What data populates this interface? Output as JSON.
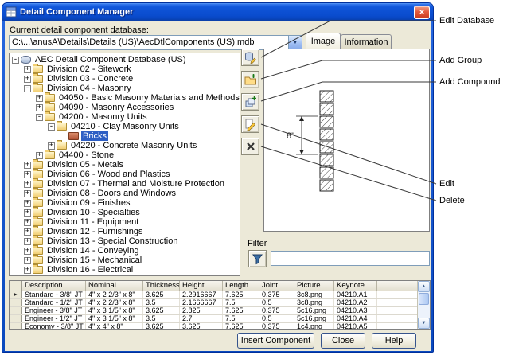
{
  "window": {
    "title": "Detail Component Manager",
    "close_glyph": "×"
  },
  "icons": {
    "scroll_up": "▲",
    "scroll_down": "▼",
    "row_pointer": "►",
    "combo_arrow": "▼"
  },
  "database": {
    "label": "Current detail component database:",
    "value": "C:\\...\\anusA\\Details\\Details (US)\\AecDtlComponents (US).mdb"
  },
  "tabs": [
    {
      "label": "Image"
    },
    {
      "label": "Information"
    }
  ],
  "tree": {
    "items": [
      {
        "level": 0,
        "exp": "-",
        "icon": "db",
        "label": "AEC Detail Component Database (US)"
      },
      {
        "level": 1,
        "exp": "+",
        "icon": "folder",
        "label": "Division 02 - Sitework"
      },
      {
        "level": 1,
        "exp": "+",
        "icon": "folder",
        "label": "Division 03 - Concrete"
      },
      {
        "level": 1,
        "exp": "-",
        "icon": "folder",
        "label": "Division 04 - Masonry"
      },
      {
        "level": 2,
        "exp": "+",
        "icon": "folder",
        "label": "04050 - Basic Masonry Materials and Methods"
      },
      {
        "level": 2,
        "exp": "+",
        "icon": "folder",
        "label": "04090 - Masonry Accessories"
      },
      {
        "level": 2,
        "exp": "-",
        "icon": "folder",
        "label": "04200 - Masonry Units"
      },
      {
        "level": 3,
        "exp": "-",
        "icon": "folder",
        "label": "04210 - Clay Masonry Units"
      },
      {
        "level": 4,
        "exp": null,
        "icon": "brick",
        "label": "Bricks",
        "selected": true
      },
      {
        "level": 3,
        "exp": "+",
        "icon": "folder",
        "label": "04220 - Concrete Masonry Units"
      },
      {
        "level": 2,
        "exp": "+",
        "icon": "folder",
        "label": "04400 - Stone"
      },
      {
        "level": 1,
        "exp": "+",
        "icon": "folder",
        "label": "Division 05 - Metals"
      },
      {
        "level": 1,
        "exp": "+",
        "icon": "folder",
        "label": "Division 06 - Wood and Plastics"
      },
      {
        "level": 1,
        "exp": "+",
        "icon": "folder",
        "label": "Division 07 - Thermal and Moisture Protection"
      },
      {
        "level": 1,
        "exp": "+",
        "icon": "folder",
        "label": "Division 08 - Doors and Windows"
      },
      {
        "level": 1,
        "exp": "+",
        "icon": "folder",
        "label": "Division 09 - Finishes"
      },
      {
        "level": 1,
        "exp": "+",
        "icon": "folder",
        "label": "Division 10 - Specialties"
      },
      {
        "level": 1,
        "exp": "+",
        "icon": "folder",
        "label": "Division 11 - Equipment"
      },
      {
        "level": 1,
        "exp": "+",
        "icon": "folder",
        "label": "Division 12 - Furnishings"
      },
      {
        "level": 1,
        "exp": "+",
        "icon": "folder",
        "label": "Division 13 - Special Construction"
      },
      {
        "level": 1,
        "exp": "+",
        "icon": "folder",
        "label": "Division 14 - Conveying"
      },
      {
        "level": 1,
        "exp": "+",
        "icon": "folder",
        "label": "Division 15 - Mechanical"
      },
      {
        "level": 1,
        "exp": "+",
        "icon": "folder",
        "label": "Division 16 - Electrical"
      }
    ]
  },
  "drawing": {
    "dimension_label": "8\""
  },
  "filter": {
    "label": "Filter",
    "value": ""
  },
  "grid": {
    "columns": [
      "Description",
      "Nominal",
      "Thickness",
      "Height",
      "Length",
      "Joint",
      "Picture",
      "Keynote"
    ],
    "selected_row": 0,
    "rows": [
      [
        "Standard - 3/8\" JT",
        "4\" x 2 2/3\" x 8\"",
        "3.625",
        "2.2916667",
        "7.625",
        "0.375",
        "3c8.png",
        "04210.A1"
      ],
      [
        "Standard - 1/2\" JT",
        "4\" x 2 2/3\" x 8\"",
        "3.5",
        "2.1666667",
        "7.5",
        "0.5",
        "3c8.png",
        "04210.A2"
      ],
      [
        "Engineer - 3/8\" JT",
        "4\" x 3 1/5\" x 8\"",
        "3.625",
        "2.825",
        "7.625",
        "0.375",
        "5c16.png",
        "04210.A3"
      ],
      [
        "Engineer - 1/2\" JT",
        "4\" x 3 1/5\" x 8\"",
        "3.5",
        "2.7",
        "7.5",
        "0.5",
        "5c16.png",
        "04210.A4"
      ],
      [
        "Economy - 3/8\" JT",
        "4\" x 4\" x 8\"",
        "3.625",
        "3.625",
        "7.625",
        "0.375",
        "1c4.png",
        "04210.A5"
      ]
    ]
  },
  "buttons": {
    "insert": "Insert Component",
    "close": "Close",
    "help": "Help"
  },
  "callouts": [
    {
      "label": "Edit Database"
    },
    {
      "label": "Add Group"
    },
    {
      "label": "Add Compound"
    },
    {
      "label": "Edit"
    },
    {
      "label": "Delete"
    }
  ],
  "colors": {
    "titlebar": "#0A4CCE",
    "selection": "#2E5FC4",
    "dialog": "#ECE9D8"
  }
}
